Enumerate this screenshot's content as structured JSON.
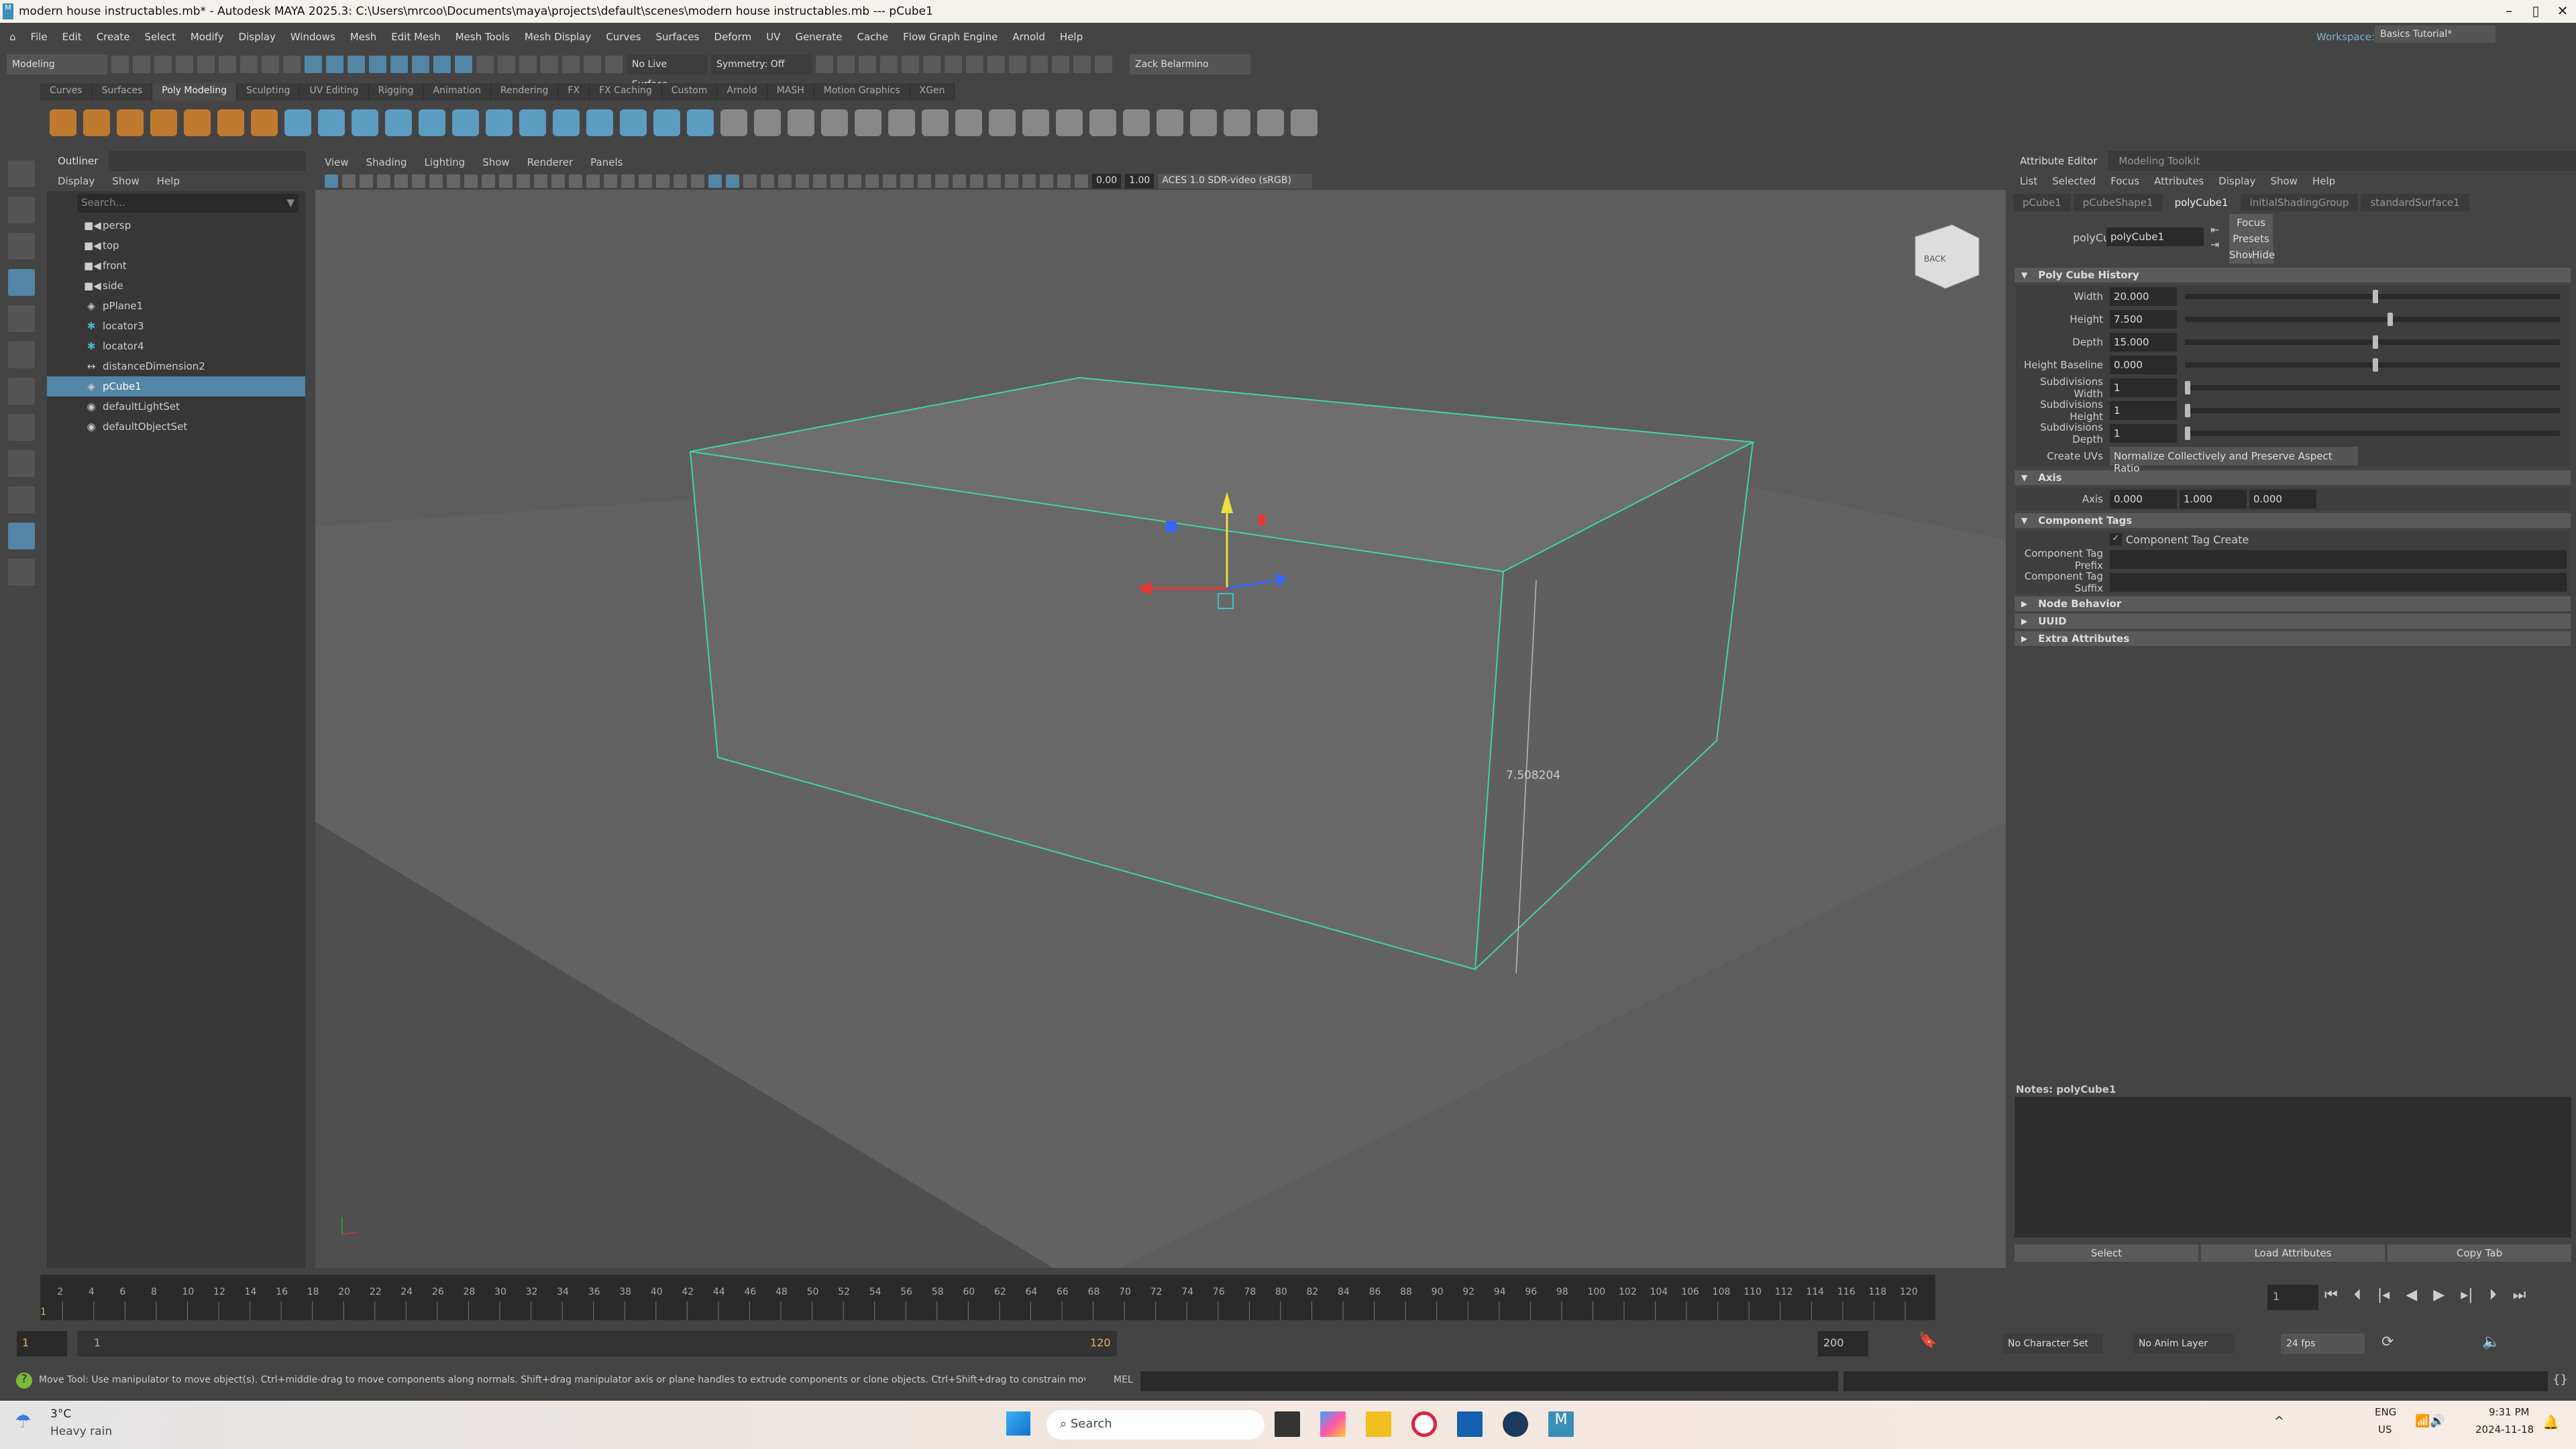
{
  "title": "modern house instructables.mb* - Autodesk MAYA 2025.3: C:\\Users\\mrcoo\\Documents\\maya\\projects\\default\\scenes\\modern house instructables.mb  ---  pCube1",
  "menus": [
    "File",
    "Edit",
    "Create",
    "Select",
    "Modify",
    "Display",
    "Windows",
    "Mesh",
    "Edit Mesh",
    "Mesh Tools",
    "Mesh Display",
    "Curves",
    "Surfaces",
    "Deform",
    "UV",
    "Generate",
    "Cache",
    "Flow Graph Engine",
    "Arnold",
    "Help"
  ],
  "workspace": {
    "label": "Workspace:",
    "value": "Basics Tutorial*"
  },
  "statusline": {
    "mode": "Modeling",
    "live_surface": "No Live Surface",
    "symmetry": "Symmetry: Off",
    "user": "Zack Belarmino"
  },
  "shelf_tabs": [
    "Curves",
    "Surfaces",
    "Poly Modeling",
    "Sculpting",
    "UV Editing",
    "Rigging",
    "Animation",
    "Rendering",
    "FX",
    "FX Caching",
    "Custom",
    "Arnold",
    "MASH",
    "Motion Graphics",
    "XGen"
  ],
  "shelf_active": "Poly Modeling",
  "outliner": {
    "tab": "Outliner",
    "menus": [
      "Display",
      "Show",
      "Help"
    ],
    "search_placeholder": "Search...",
    "items": [
      {
        "label": "persp",
        "icon": "camera"
      },
      {
        "label": "top",
        "icon": "camera"
      },
      {
        "label": "front",
        "icon": "camera"
      },
      {
        "label": "side",
        "icon": "camera"
      },
      {
        "label": "pPlane1",
        "icon": "mesh"
      },
      {
        "label": "locator3",
        "icon": "locator"
      },
      {
        "label": "locator4",
        "icon": "locator"
      },
      {
        "label": "distanceDimension2",
        "icon": "distance"
      },
      {
        "label": "pCube1",
        "icon": "mesh",
        "selected": true
      },
      {
        "label": "defaultLightSet",
        "icon": "set"
      },
      {
        "label": "defaultObjectSet",
        "icon": "set"
      }
    ]
  },
  "viewport": {
    "menus": [
      "View",
      "Shading",
      "Lighting",
      "Show",
      "Renderer",
      "Panels"
    ],
    "exposure": "0.00",
    "gamma": "1.00",
    "color_space": "ACES 1.0 SDR-video (sRGB)",
    "measurement": "7.508204",
    "viewcube": "BACK",
    "wire_color": "#3fd6a0"
  },
  "attr": {
    "tabs": [
      "Attribute Editor",
      "Modeling Toolkit"
    ],
    "menus": [
      "List",
      "Selected",
      "Focus",
      "Attributes",
      "Display",
      "Show",
      "Help"
    ],
    "node_tabs": [
      "pCube1",
      "pCubeShape1",
      "polyCube1",
      "initialShadingGroup",
      "standardSurface1"
    ],
    "active_node": "polyCube1",
    "node_label": "polyCube:",
    "node_value": "polyCube1",
    "focus": "Focus",
    "presets": "Presets",
    "show": "Show",
    "hide": "Hide",
    "sections": {
      "history": "Poly Cube History",
      "axis": "Axis",
      "tags": "Component Tags",
      "node_behavior": "Node Behavior",
      "uuid": "UUID",
      "extra": "Extra Attributes"
    },
    "fields": [
      {
        "label": "Width",
        "value": "20.000",
        "slider": 0.5
      },
      {
        "label": "Height",
        "value": "7.500",
        "slider": 0.54
      },
      {
        "label": "Depth",
        "value": "15.000",
        "slider": 0.5
      },
      {
        "label": "Height Baseline",
        "value": "0.000",
        "slider": 0.5
      },
      {
        "label": "Subdivisions Width",
        "value": "1",
        "slider": 0
      },
      {
        "label": "Subdivisions Height",
        "value": "1",
        "slider": 0
      },
      {
        "label": "Subdivisions Depth",
        "value": "1",
        "slider": 0
      }
    ],
    "create_uvs_label": "Create UVs",
    "create_uvs": "Normalize Collectively and Preserve Aspect Ratio",
    "axis_label": "Axis",
    "axis": [
      "0.000",
      "1.000",
      "0.000"
    ],
    "tag_create": "Component Tag Create",
    "tag_prefix": "Component Tag Prefix",
    "tag_suffix": "Component Tag Suffix",
    "notes": "Notes:  polyCube1",
    "buttons": [
      "Select",
      "Load Attributes",
      "Copy Tab"
    ]
  },
  "timeline": {
    "start": 1,
    "end": 120,
    "step": 2,
    "current": "1"
  },
  "range": {
    "start": "1",
    "inner_start": "1",
    "inner_end": "120",
    "end": "200",
    "character_set": "No Character Set",
    "anim_layer": "No Anim Layer",
    "fps": "24 fps"
  },
  "help_line": "Move Tool: Use manipulator to move object(s). Ctrl+middle-drag to move components along normals. Shift+drag manipulator axis or plane handles to extrude components or clone objects. Ctrl+Shift+drag to constrain movement to a co",
  "cmd_lang": "MEL",
  "taskbar": {
    "temp": "3°C",
    "weather": "Heavy rain",
    "search": "Search",
    "lang1": "ENG",
    "lang2": "US",
    "time": "9:31 PM",
    "date": "2024-11-18"
  }
}
